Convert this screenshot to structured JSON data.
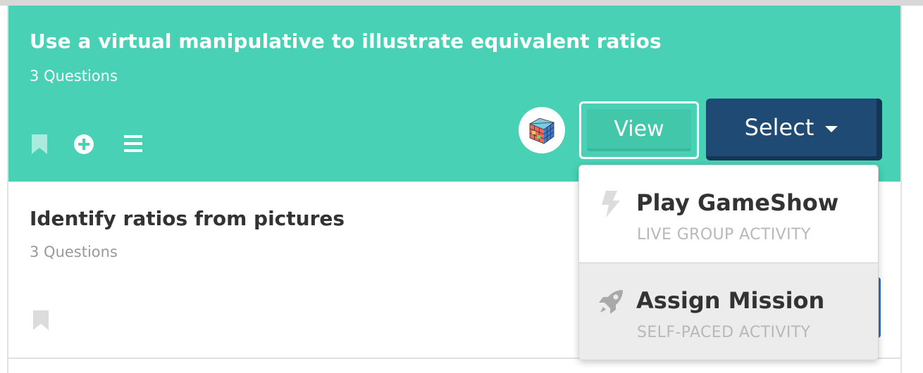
{
  "colors": {
    "card_active_bg": "#48d1b4",
    "select_bg": "#1f4a73",
    "text_dark": "#333333",
    "text_muted": "#999999"
  },
  "cards": [
    {
      "title": "Use a virtual manipulative to illustrate equivalent ratios",
      "count": "3 Questions",
      "icons": [
        "bookmark-icon",
        "plus-circle-icon",
        "menu-icon"
      ],
      "view_label": "View",
      "select_label": "Select"
    },
    {
      "title": "Identify ratios from pictures",
      "count": "3 Questions",
      "icons": [
        "bookmark-icon"
      ]
    }
  ],
  "dropdown": {
    "items": [
      {
        "label": "Play GameShow",
        "sub": "LIVE GROUP ACTIVITY",
        "icon": "lightning-icon"
      },
      {
        "label": "Assign Mission",
        "sub": "SELF-PACED ACTIVITY",
        "icon": "rocket-icon"
      }
    ]
  }
}
